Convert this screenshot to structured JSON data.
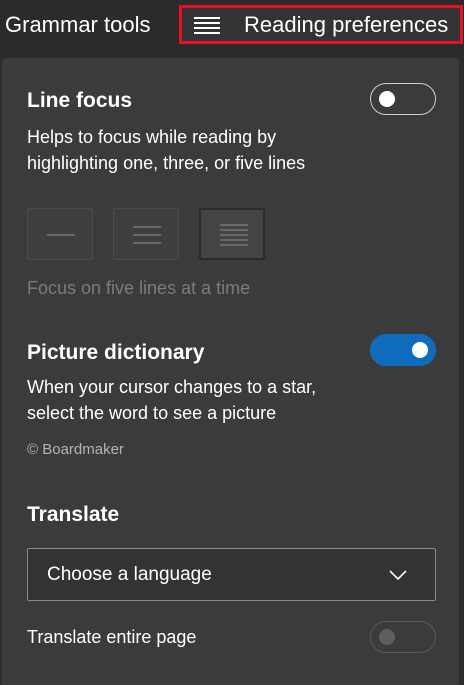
{
  "topbar": {
    "grammar_tab": "Grammar tools",
    "reading_tab": "Reading preferences",
    "reading_icon": "lines-icon"
  },
  "line_focus": {
    "title": "Line focus",
    "description": "Helps to focus while reading by highlighting one, three, or five lines",
    "enabled": false,
    "options": [
      "one-line-icon",
      "three-lines-icon",
      "five-lines-icon"
    ],
    "selected_option": "five-lines-icon",
    "status": "Focus on five lines at a time"
  },
  "picture_dictionary": {
    "title": "Picture dictionary",
    "description": "When your cursor changes to a star, select the word to see a picture",
    "enabled": true,
    "credit": "© Boardmaker"
  },
  "translate": {
    "title": "Translate",
    "language_placeholder": "Choose a language",
    "entire_page_label": "Translate entire page",
    "entire_page_enabled": false
  },
  "colors": {
    "accent": "#0f6cbd",
    "highlight_border": "#e81123",
    "panel": "#3b3b3b"
  }
}
